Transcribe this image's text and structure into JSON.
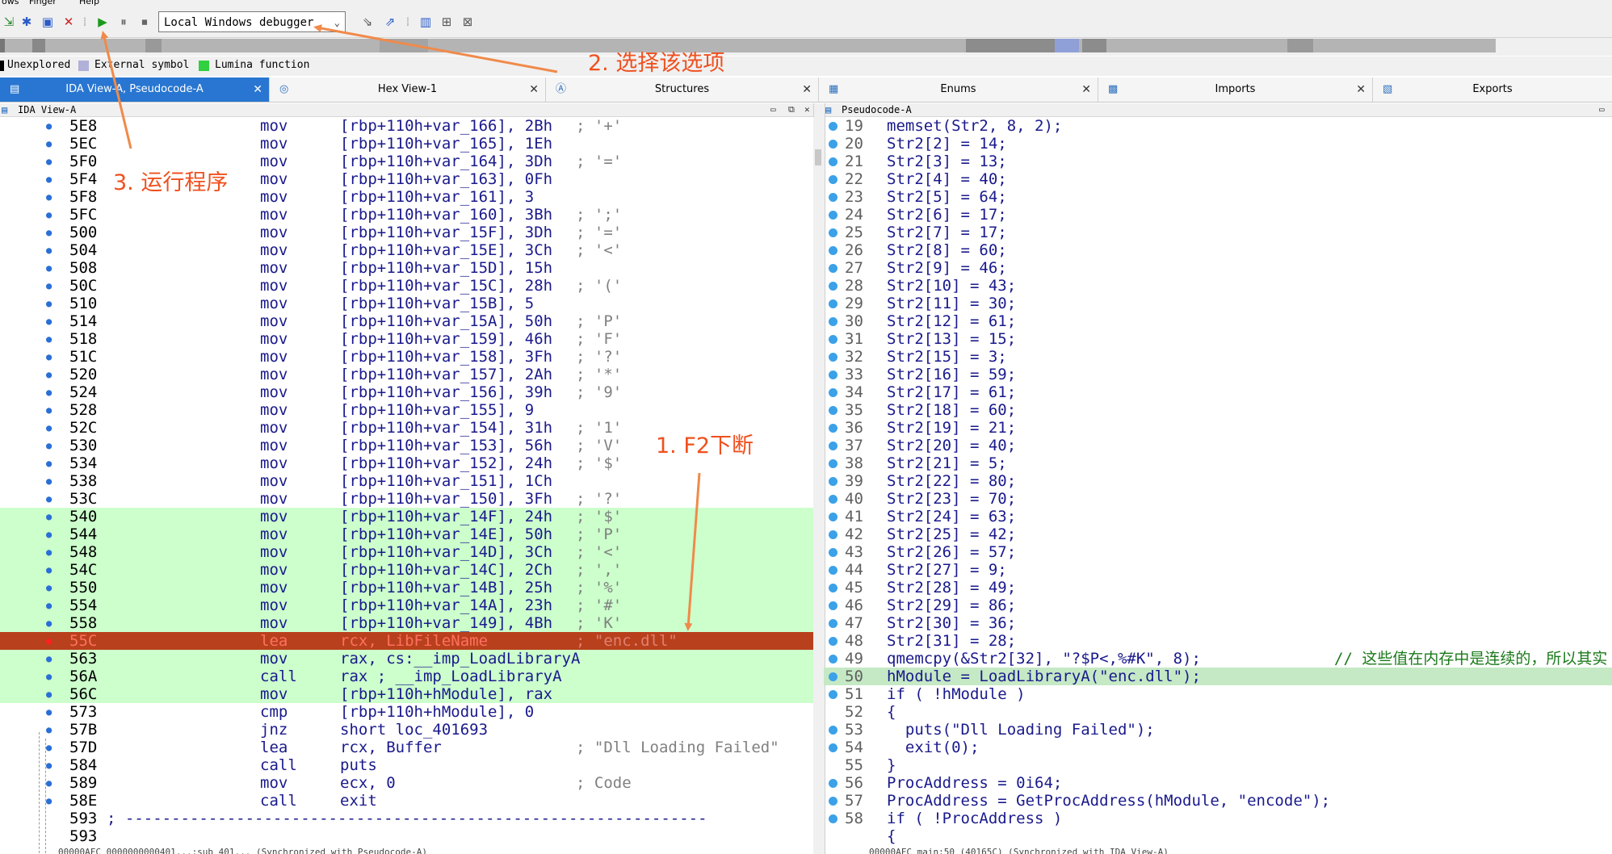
{
  "menu": {
    "items": [
      "ows",
      "Finger",
      "Help"
    ]
  },
  "toolbar": {
    "debugger_select": "Local Windows debugger",
    "colors": {
      "run": "#1a9a1a",
      "stop": "#cc2020"
    }
  },
  "legend": {
    "items": [
      {
        "label": "Unexplored",
        "color": "#000000"
      },
      {
        "label": "External symbol",
        "color": "#b0b0d8"
      },
      {
        "label": "Lumina function",
        "color": "#30d040"
      }
    ]
  },
  "tabs": [
    {
      "label": "IDA View-A, Pseudocode-A",
      "icon": "ida-view-icon",
      "active": true
    },
    {
      "label": "Hex View-1",
      "icon": "hex-view-icon",
      "active": false
    },
    {
      "label": "Structures",
      "icon": "structures-icon",
      "active": false
    },
    {
      "label": "Enums",
      "icon": "enums-icon",
      "active": false
    },
    {
      "label": "Imports",
      "icon": "imports-icon",
      "active": false
    },
    {
      "label": "Exports",
      "icon": "exports-icon",
      "active": false
    }
  ],
  "left_panel": {
    "title": "IDA View-A",
    "lines": [
      {
        "addr": "5E8",
        "mn": "mov",
        "op": "[rbp+110h+var_166], 2Bh",
        "cm": "; '+'"
      },
      {
        "addr": "5EC",
        "mn": "mov",
        "op": "[rbp+110h+var_165], 1Eh",
        "cm": ""
      },
      {
        "addr": "5F0",
        "mn": "mov",
        "op": "[rbp+110h+var_164], 3Dh",
        "cm": "; '='"
      },
      {
        "addr": "5F4",
        "mn": "mov",
        "op": "[rbp+110h+var_163], 0Fh",
        "cm": ""
      },
      {
        "addr": "5F8",
        "mn": "mov",
        "op": "[rbp+110h+var_161], 3",
        "cm": ""
      },
      {
        "addr": "5FC",
        "mn": "mov",
        "op": "[rbp+110h+var_160], 3Bh",
        "cm": "; ';'"
      },
      {
        "addr": "500",
        "mn": "mov",
        "op": "[rbp+110h+var_15F], 3Dh",
        "cm": "; '='"
      },
      {
        "addr": "504",
        "mn": "mov",
        "op": "[rbp+110h+var_15E], 3Ch",
        "cm": "; '<'"
      },
      {
        "addr": "508",
        "mn": "mov",
        "op": "[rbp+110h+var_15D], 15h",
        "cm": ""
      },
      {
        "addr": "50C",
        "mn": "mov",
        "op": "[rbp+110h+var_15C], 28h",
        "cm": "; '('"
      },
      {
        "addr": "510",
        "mn": "mov",
        "op": "[rbp+110h+var_15B], 5",
        "cm": ""
      },
      {
        "addr": "514",
        "mn": "mov",
        "op": "[rbp+110h+var_15A], 50h",
        "cm": "; 'P'"
      },
      {
        "addr": "518",
        "mn": "mov",
        "op": "[rbp+110h+var_159], 46h",
        "cm": "; 'F'"
      },
      {
        "addr": "51C",
        "mn": "mov",
        "op": "[rbp+110h+var_158], 3Fh",
        "cm": "; '?'"
      },
      {
        "addr": "520",
        "mn": "mov",
        "op": "[rbp+110h+var_157], 2Ah",
        "cm": "; '*'"
      },
      {
        "addr": "524",
        "mn": "mov",
        "op": "[rbp+110h+var_156], 39h",
        "cm": "; '9'"
      },
      {
        "addr": "528",
        "mn": "mov",
        "op": "[rbp+110h+var_155], 9",
        "cm": ""
      },
      {
        "addr": "52C",
        "mn": "mov",
        "op": "[rbp+110h+var_154], 31h",
        "cm": "; '1'"
      },
      {
        "addr": "530",
        "mn": "mov",
        "op": "[rbp+110h+var_153], 56h",
        "cm": "; 'V'"
      },
      {
        "addr": "534",
        "mn": "mov",
        "op": "[rbp+110h+var_152], 24h",
        "cm": "; '$'"
      },
      {
        "addr": "538",
        "mn": "mov",
        "op": "[rbp+110h+var_151], 1Ch",
        "cm": ""
      },
      {
        "addr": "53C",
        "mn": "mov",
        "op": "[rbp+110h+var_150], 3Fh",
        "cm": "; '?'"
      },
      {
        "addr": "540",
        "mn": "mov",
        "op": "[rbp+110h+var_14F], 24h",
        "cm": "; '$'",
        "hl": true
      },
      {
        "addr": "544",
        "mn": "mov",
        "op": "[rbp+110h+var_14E], 50h",
        "cm": "; 'P'",
        "hl": true
      },
      {
        "addr": "548",
        "mn": "mov",
        "op": "[rbp+110h+var_14D], 3Ch",
        "cm": "; '<'",
        "hl": true
      },
      {
        "addr": "54C",
        "mn": "mov",
        "op": "[rbp+110h+var_14C], 2Ch",
        "cm": "; ','",
        "hl": true
      },
      {
        "addr": "550",
        "mn": "mov",
        "op": "[rbp+110h+var_14B], 25h",
        "cm": "; '%'",
        "hl": true
      },
      {
        "addr": "554",
        "mn": "mov",
        "op": "[rbp+110h+var_14A], 23h",
        "cm": "; '#'",
        "hl": true
      },
      {
        "addr": "558",
        "mn": "mov",
        "op": "[rbp+110h+var_149], 4Bh",
        "cm": "; 'K'",
        "hl": true
      },
      {
        "addr": "55C",
        "mn": "lea",
        "op": "rcx, LibFileName",
        "cm": "; \"enc.dll\"",
        "bp": true
      },
      {
        "addr": "563",
        "mn": "mov",
        "op": "rax, cs:__imp_LoadLibraryA",
        "cm": "",
        "hl": true
      },
      {
        "addr": "56A",
        "mn": "call",
        "op": "rax ; __imp_LoadLibraryA",
        "cm": "",
        "hl": true
      },
      {
        "addr": "56C",
        "mn": "mov",
        "op": "[rbp+110h+hModule], rax",
        "cm": "",
        "hl": true
      },
      {
        "addr": "573",
        "mn": "cmp",
        "op": "[rbp+110h+hModule], 0",
        "cm": ""
      },
      {
        "addr": "57B",
        "mn": "jnz",
        "op": "short loc_401693",
        "cm": ""
      },
      {
        "addr": "57D",
        "mn": "lea",
        "op": "rcx, Buffer",
        "cm": "; \"Dll Loading Failed\""
      },
      {
        "addr": "584",
        "mn": "call",
        "op": "puts",
        "cm": ""
      },
      {
        "addr": "589",
        "mn": "mov",
        "op": "ecx, 0",
        "cm": "; Code"
      },
      {
        "addr": "58E",
        "mn": "call",
        "op": "exit",
        "cm": ""
      },
      {
        "addr": "593",
        "mn": "",
        "op": "; ---------------------------------------------------------------",
        "cm": ""
      },
      {
        "addr": "593",
        "mn": "",
        "op": "",
        "cm": ""
      }
    ],
    "status": "00000AFC 0000000000401...:sub_401... (Synchronized with Pseudocode-A)"
  },
  "right_panel": {
    "title": "Pseudocode-A",
    "lines": [
      {
        "n": "19",
        "code": "memset(Str2, 8, 2);"
      },
      {
        "n": "20",
        "code": "Str2[2] = 14;"
      },
      {
        "n": "21",
        "code": "Str2[3] = 13;"
      },
      {
        "n": "22",
        "code": "Str2[4] = 40;"
      },
      {
        "n": "23",
        "code": "Str2[5] = 64;"
      },
      {
        "n": "24",
        "code": "Str2[6] = 17;"
      },
      {
        "n": "25",
        "code": "Str2[7] = 17;"
      },
      {
        "n": "26",
        "code": "Str2[8] = 60;"
      },
      {
        "n": "27",
        "code": "Str2[9] = 46;"
      },
      {
        "n": "28",
        "code": "Str2[10] = 43;"
      },
      {
        "n": "29",
        "code": "Str2[11] = 30;"
      },
      {
        "n": "30",
        "code": "Str2[12] = 61;"
      },
      {
        "n": "31",
        "code": "Str2[13] = 15;"
      },
      {
        "n": "32",
        "code": "Str2[15] = 3;"
      },
      {
        "n": "33",
        "code": "Str2[16] = 59;"
      },
      {
        "n": "34",
        "code": "Str2[17] = 61;"
      },
      {
        "n": "35",
        "code": "Str2[18] = 60;"
      },
      {
        "n": "36",
        "code": "Str2[19] = 21;"
      },
      {
        "n": "37",
        "code": "Str2[20] = 40;"
      },
      {
        "n": "38",
        "code": "Str2[21] = 5;"
      },
      {
        "n": "39",
        "code": "Str2[22] = 80;"
      },
      {
        "n": "40",
        "code": "Str2[23] = 70;"
      },
      {
        "n": "41",
        "code": "Str2[24] = 63;"
      },
      {
        "n": "42",
        "code": "Str2[25] = 42;"
      },
      {
        "n": "43",
        "code": "Str2[26] = 57;"
      },
      {
        "n": "44",
        "code": "Str2[27] = 9;"
      },
      {
        "n": "45",
        "code": "Str2[28] = 49;"
      },
      {
        "n": "46",
        "code": "Str2[29] = 86;"
      },
      {
        "n": "47",
        "code": "Str2[30] = 36;"
      },
      {
        "n": "48",
        "code": "Str2[31] = 28;"
      },
      {
        "n": "49",
        "code": "qmemcpy(&Str2[32], \"?$P<,%#K\", 8);",
        "cmt": "// 这些值在内存中是连续的，所以其实"
      },
      {
        "n": "50",
        "code": "hModule = LoadLibraryA(\"enc.dll\");",
        "hl": true
      },
      {
        "n": "51",
        "code": "if ( !hModule )"
      },
      {
        "n": "52",
        "code": "{",
        "nodot": true
      },
      {
        "n": "53",
        "code": "  puts(\"Dll Loading Failed\");"
      },
      {
        "n": "54",
        "code": "  exit(0);"
      },
      {
        "n": "55",
        "code": "}",
        "nodot": true
      },
      {
        "n": "56",
        "code": "ProcAddress = 0i64;"
      },
      {
        "n": "57",
        "code": "ProcAddress = GetProcAddress(hModule, \"encode\");"
      },
      {
        "n": "58",
        "code": "if ( !ProcAddress )"
      },
      {
        "n": "",
        "code": "{",
        "nodot": true
      }
    ],
    "status": "00000AFC main:50 (40165C) (Synchronized with IDA View-A)"
  },
  "annotations": {
    "step1": "1. F2下断",
    "step2": "2. 选择该选项",
    "step3": "3. 运行程序",
    "color": "#f0501e"
  }
}
